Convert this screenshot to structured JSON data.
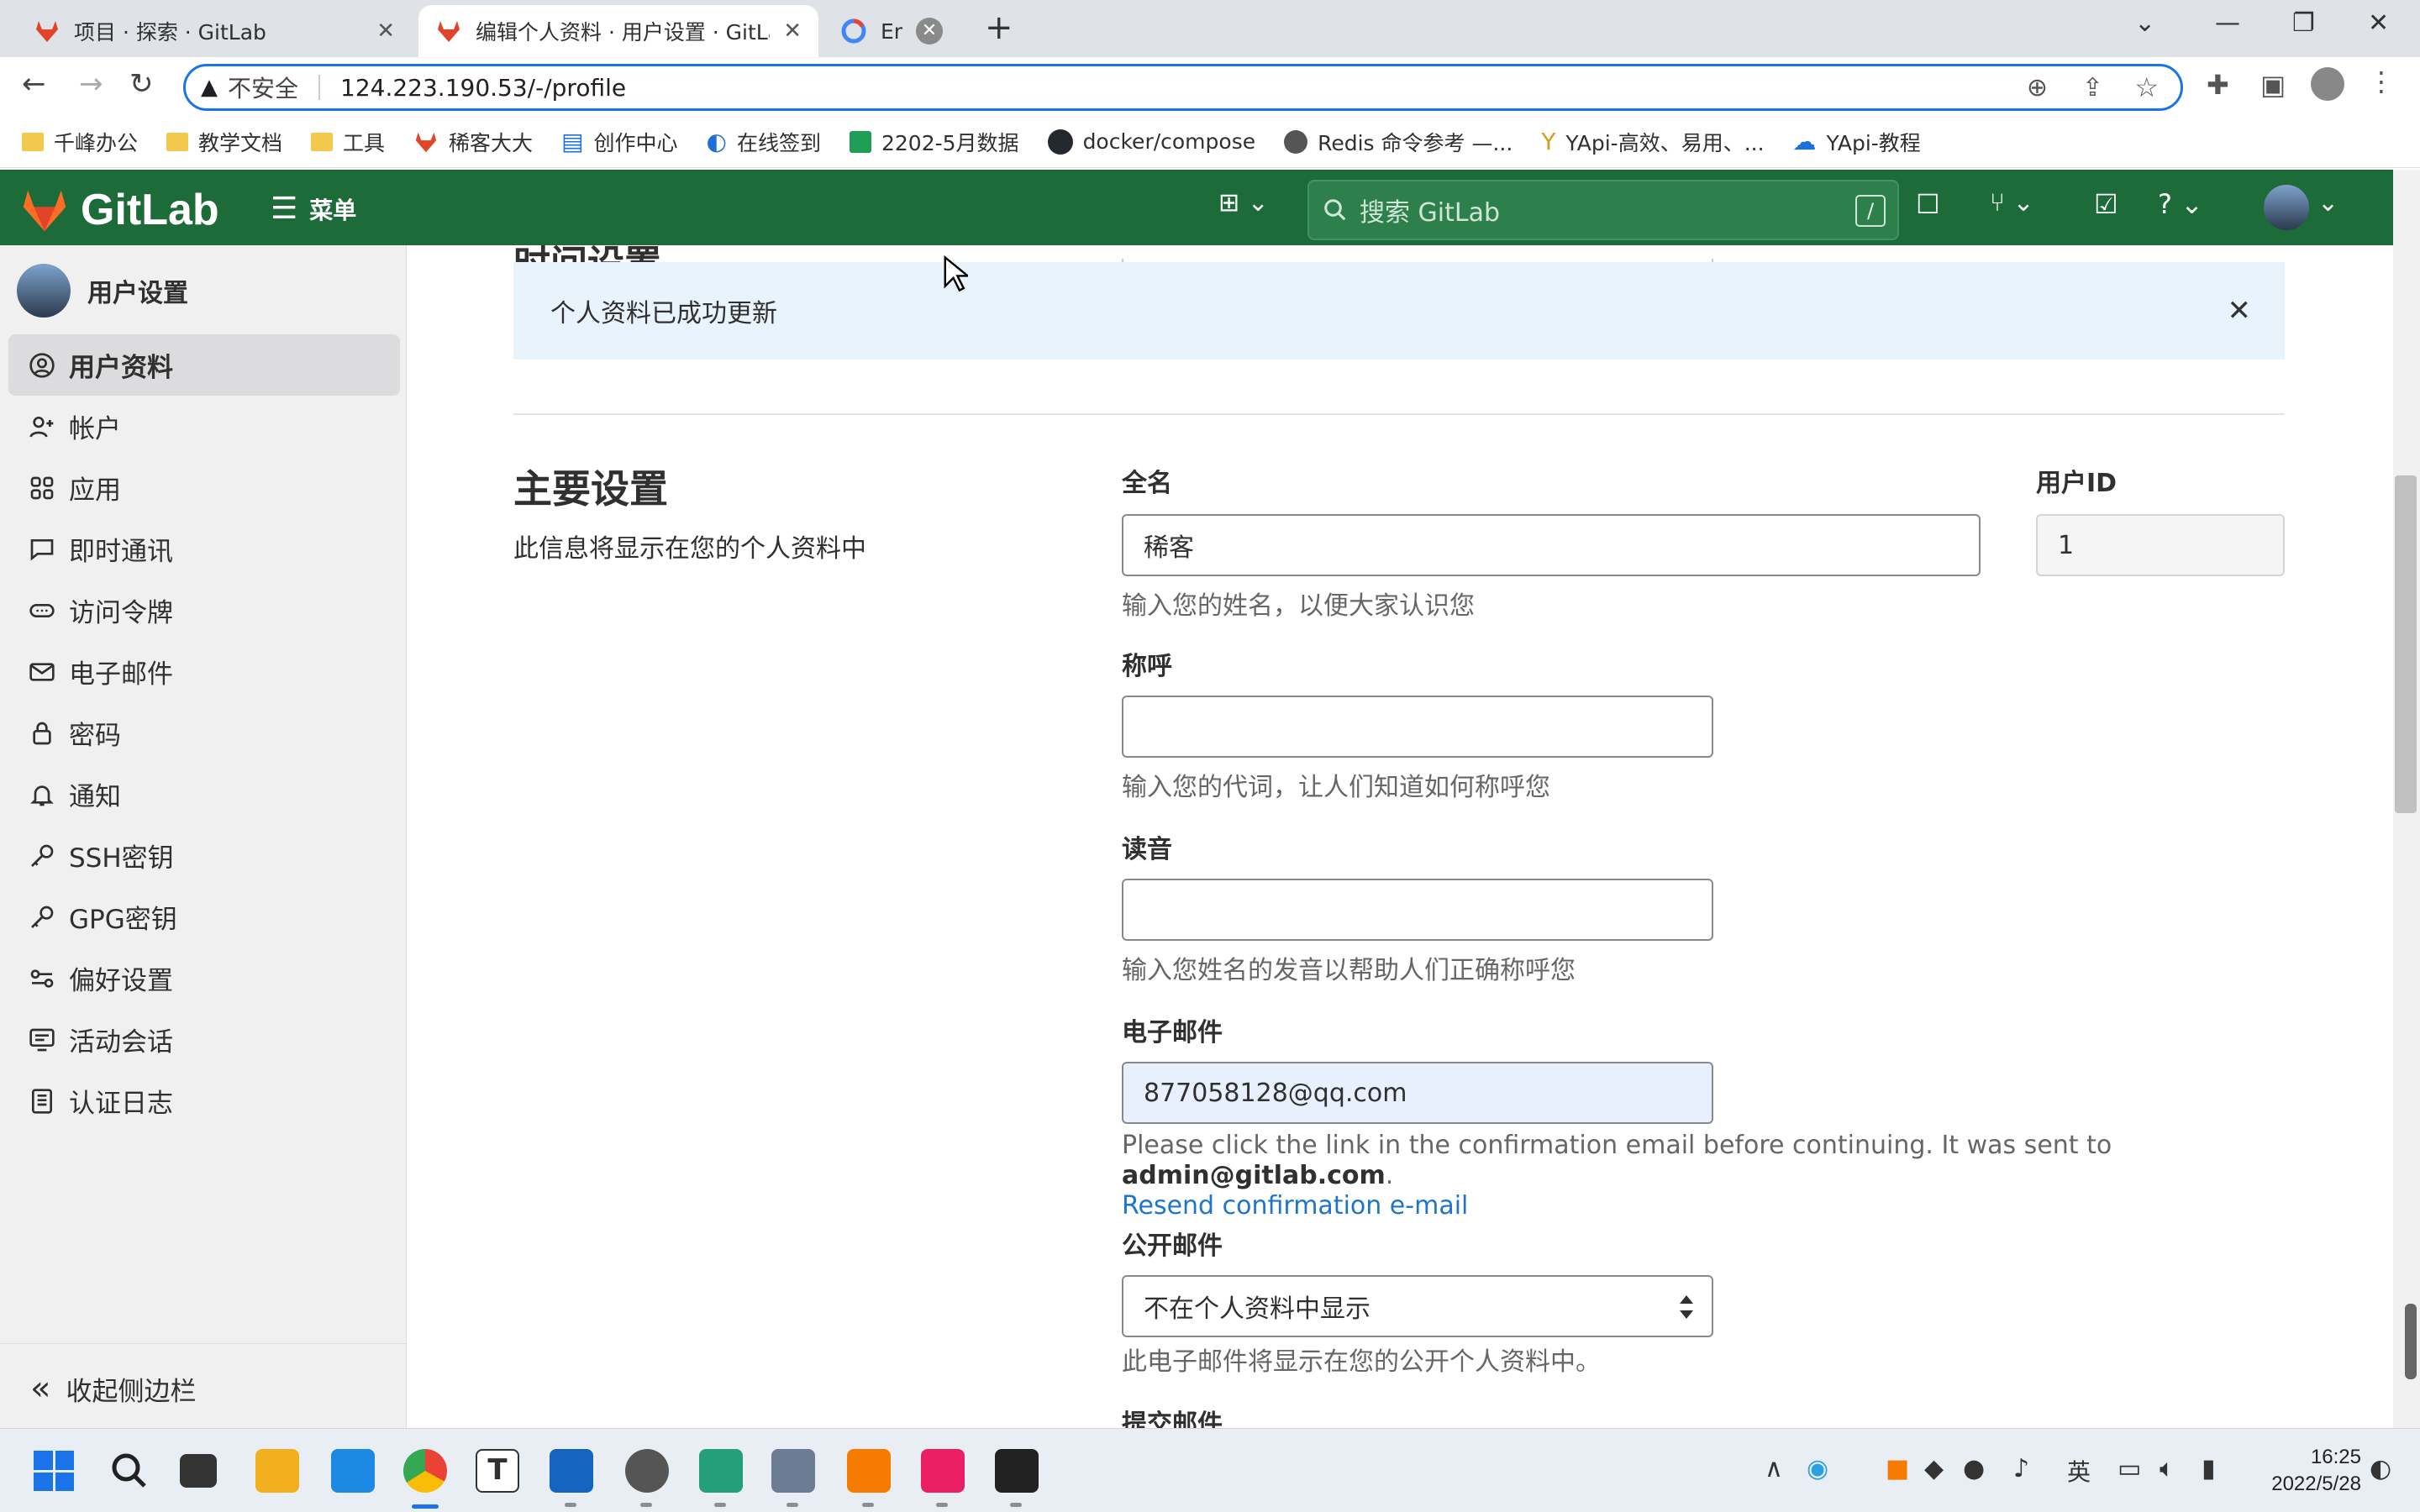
{
  "browser": {
    "tabs": [
      {
        "title": "项目 · 探索 · GitLab"
      },
      {
        "title": "编辑个人资料 · 用户设置 · GitLab"
      },
      {
        "title": "Ema"
      }
    ],
    "new_tab": "+",
    "security_label": "不安全",
    "url": "124.223.190.53/-/profile",
    "bookmarks": [
      {
        "label": "千峰办公"
      },
      {
        "label": "教学文档"
      },
      {
        "label": "工具"
      },
      {
        "label": "稀客大大"
      },
      {
        "label": "创作中心"
      },
      {
        "label": "在线签到"
      },
      {
        "label": "2202-5月数据"
      },
      {
        "label": "docker/compose"
      },
      {
        "label": "Redis 命令参考 —..."
      },
      {
        "label": "YApi-高效、易用、..."
      },
      {
        "label": "YApi-教程"
      }
    ]
  },
  "gitlab": {
    "logo_text": "GitLab",
    "menu_label": "菜单",
    "search_placeholder": "搜索 GitLab",
    "search_shortcut": "/"
  },
  "sidebar": {
    "title": "用户设置",
    "items": [
      {
        "label": "用户资料",
        "icon": "profile-icon"
      },
      {
        "label": "帐户",
        "icon": "account-icon"
      },
      {
        "label": "应用",
        "icon": "applications-icon"
      },
      {
        "label": "即时通讯",
        "icon": "chat-icon"
      },
      {
        "label": "访问令牌",
        "icon": "token-icon"
      },
      {
        "label": "电子邮件",
        "icon": "mail-icon"
      },
      {
        "label": "密码",
        "icon": "lock-icon"
      },
      {
        "label": "通知",
        "icon": "bell-icon"
      },
      {
        "label": "SSH密钥",
        "icon": "key-icon"
      },
      {
        "label": "GPG密钥",
        "icon": "key-icon"
      },
      {
        "label": "偏好设置",
        "icon": "preferences-icon"
      },
      {
        "label": "活动会话",
        "icon": "sessions-icon"
      },
      {
        "label": "认证日志",
        "icon": "log-icon"
      }
    ],
    "collapse_label": "收起侧边栏"
  },
  "main": {
    "prev_section_title": "时间设置",
    "alert": "个人资料已成功更新",
    "section_title": "主要设置",
    "section_desc": "此信息将显示在您的个人资料中",
    "fullname": {
      "label": "全名",
      "value": "稀客",
      "help": "输入您的姓名，以便大家认识您"
    },
    "userid": {
      "label": "用户ID",
      "value": "1"
    },
    "pronouns": {
      "label": "称呼",
      "value": "",
      "help": "输入您的代词，让人们知道如何称呼您"
    },
    "pronunciation": {
      "label": "读音",
      "value": "",
      "help": "输入您姓名的发音以帮助人们正确称呼您"
    },
    "email": {
      "label": "电子邮件",
      "value": "877058128@qq.com",
      "note": "Please click the link in the confirmation email before continuing. It was sent to",
      "note_email": "admin@gitlab.com",
      "note_end": ".",
      "resend": "Resend confirmation e-mail"
    },
    "public_email": {
      "label": "公开邮件",
      "value": "不在个人资料中显示",
      "help": "此电子邮件将显示在您的公开个人资料中。"
    },
    "commit_email": {
      "label": "提交邮件"
    }
  },
  "taskbar": {
    "time": "16:25",
    "date": "2022/5/28",
    "ime": "英"
  },
  "colors": {
    "gitlab_nav": "#1c6b39",
    "alert_bg": "#e8f3fc",
    "link": "#1f75cb",
    "url_border": "#1a73e8"
  }
}
